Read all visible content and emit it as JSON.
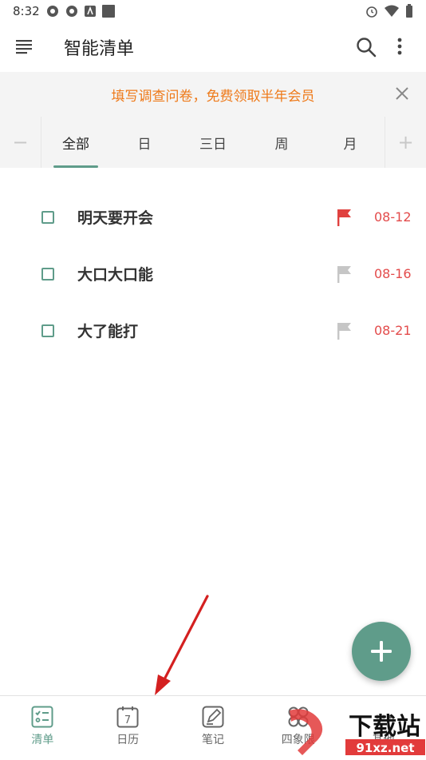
{
  "status": {
    "time": "8:32"
  },
  "appbar": {
    "title": "智能清单"
  },
  "banner": {
    "text": "填写调查问卷，免费领取半年会员"
  },
  "tabs": {
    "minus": "−",
    "plus": "+",
    "items": [
      {
        "label": "全部",
        "active": true
      },
      {
        "label": "日"
      },
      {
        "label": "三日"
      },
      {
        "label": "周"
      },
      {
        "label": "月"
      }
    ]
  },
  "tasks": [
    {
      "name": "明天要开会",
      "date": "08-12",
      "flag_color": "#e0413f"
    },
    {
      "name": "大口大口能",
      "date": "08-16",
      "flag_color": "#c6c6c6"
    },
    {
      "name": "大了能打",
      "date": "08-21",
      "flag_color": "#c6c6c6"
    }
  ],
  "bottom_nav": [
    {
      "label": "清单",
      "icon": "checklist-icon",
      "active": true
    },
    {
      "label": "日历",
      "icon": "calendar-icon",
      "badge": "7"
    },
    {
      "label": "笔记",
      "icon": "note-icon"
    },
    {
      "label": "四象限",
      "icon": "quadrant-icon"
    },
    {
      "label": "其他",
      "icon": "other-icon"
    }
  ],
  "colors": {
    "accent": "#5f9c8a",
    "banner_text": "#ee7a1a",
    "date_text": "#e34b4b",
    "arrow": "#d42020"
  },
  "watermark": {
    "brand": "下载站",
    "domain": "91xz.net"
  }
}
